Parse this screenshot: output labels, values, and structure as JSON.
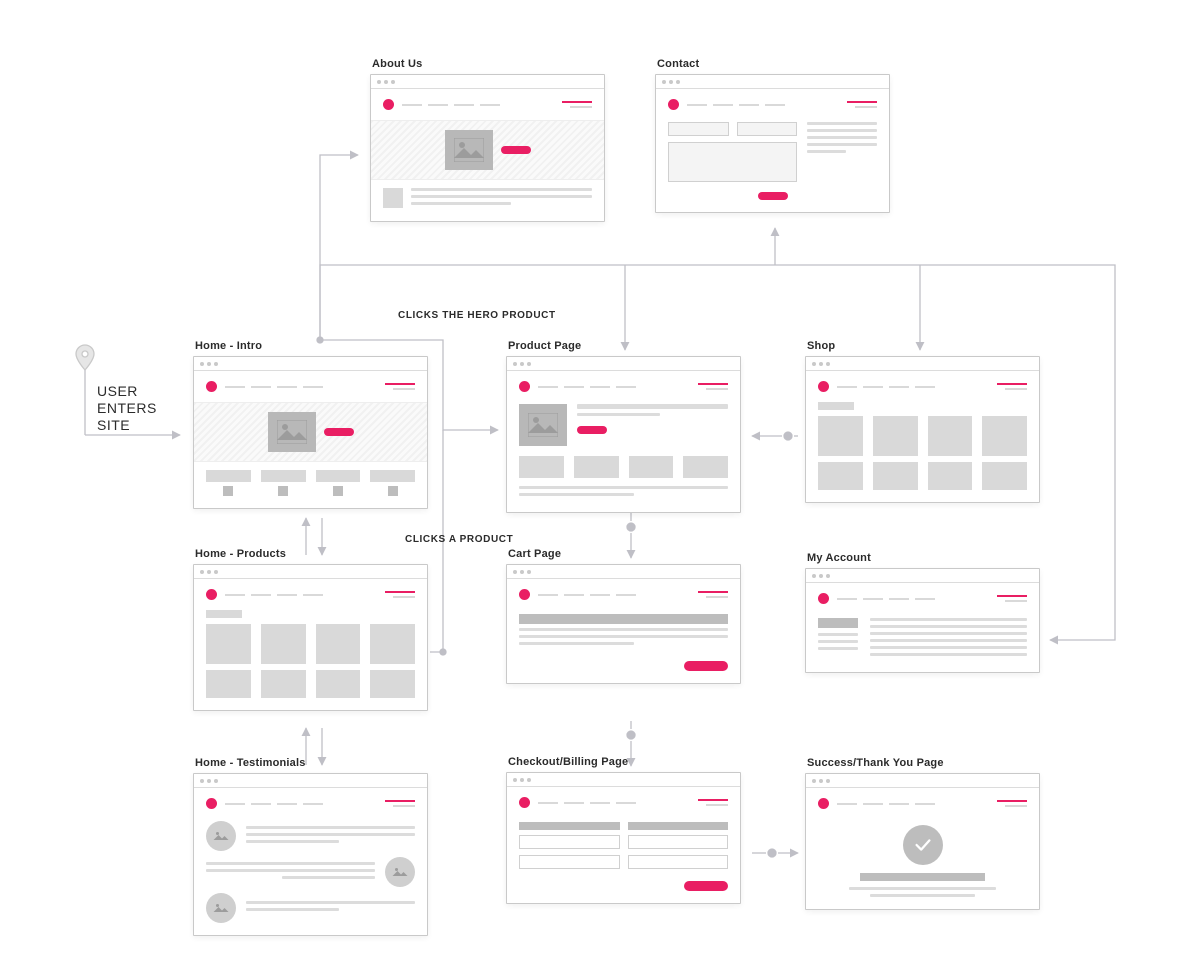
{
  "colors": {
    "accent": "#e91e63",
    "line": "#bfbfc6",
    "block": "#bdbdbd"
  },
  "entry": {
    "label": "USER\nENTERS\nSITE"
  },
  "annotations": {
    "hero_click": "CLICKS THE HERO PRODUCT",
    "product_click": "CLICKS A PRODUCT"
  },
  "cards": {
    "about": {
      "title": "About Us"
    },
    "contact": {
      "title": "Contact"
    },
    "home_intro": {
      "title": "Home - Intro"
    },
    "product": {
      "title": "Product Page"
    },
    "shop": {
      "title": "Shop"
    },
    "home_prods": {
      "title": "Home - Products"
    },
    "cart": {
      "title": "Cart Page"
    },
    "account": {
      "title": "My Account"
    },
    "home_test": {
      "title": "Home - Testimonials"
    },
    "checkout": {
      "title": "Checkout/Billing Page"
    },
    "success": {
      "title": "Success/Thank You Page"
    }
  }
}
